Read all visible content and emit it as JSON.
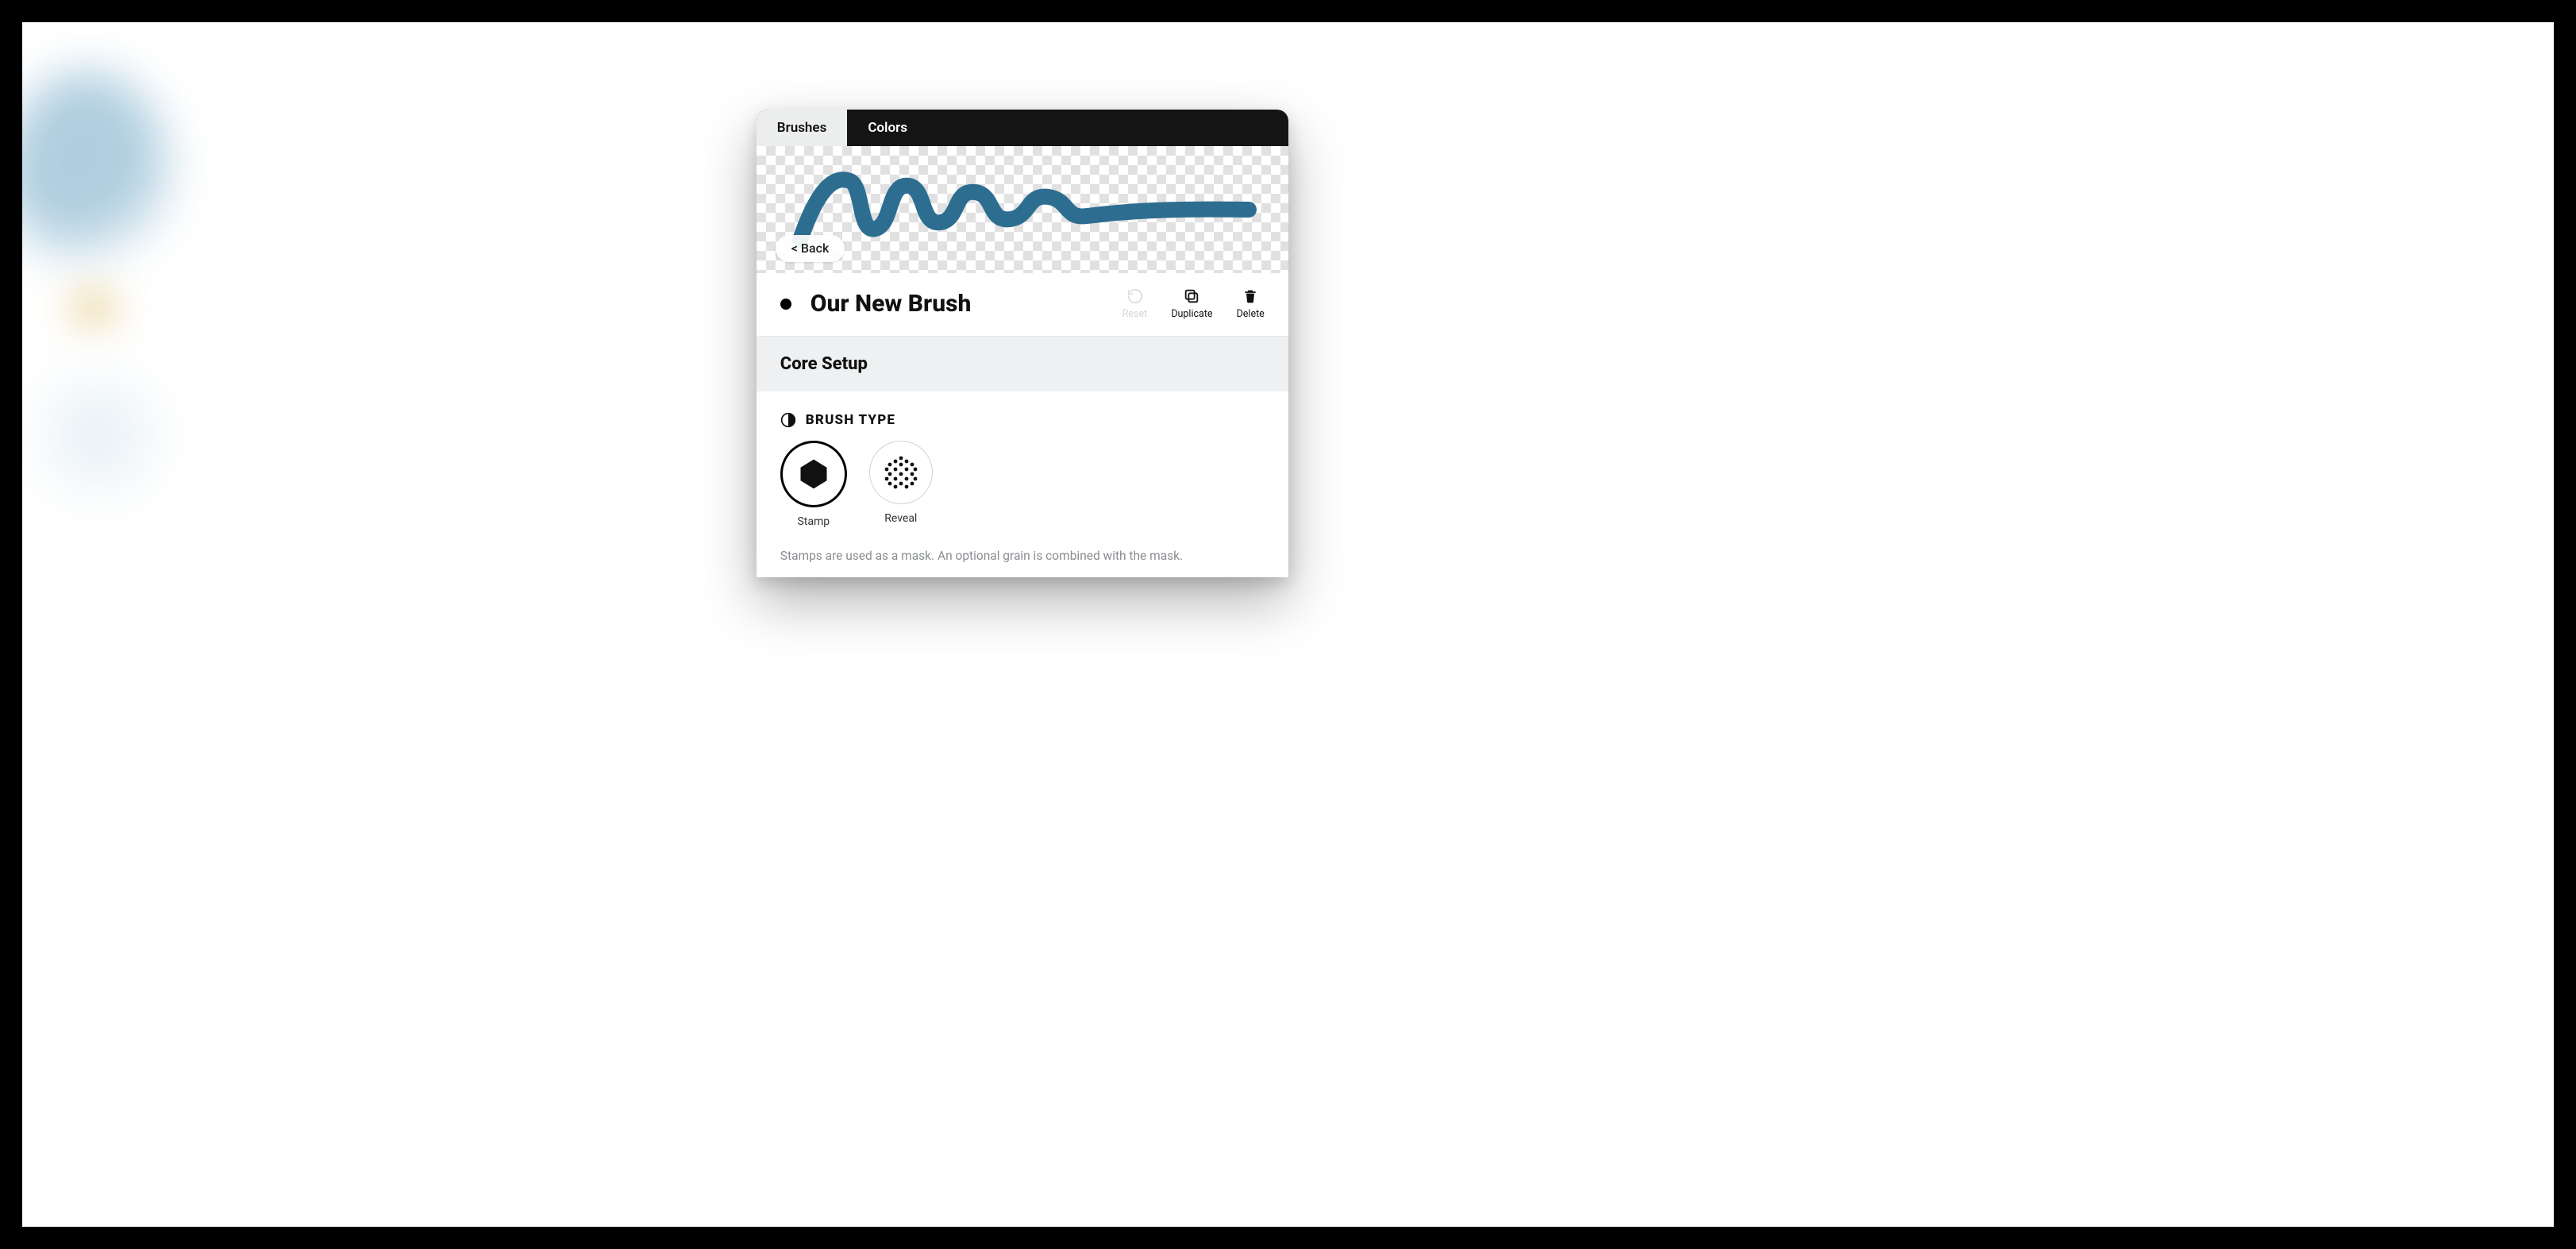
{
  "tabs": {
    "brushes": "Brushes",
    "colors": "Colors"
  },
  "nav": {
    "back": "< Back"
  },
  "brush": {
    "name": "Our New Brush",
    "stroke_color": "#2d6e90"
  },
  "actions": {
    "reset": "Reset",
    "duplicate": "Duplicate",
    "delete": "Delete"
  },
  "sections": {
    "core_setup": "Core Setup"
  },
  "brush_type": {
    "heading": "BRUSH TYPE",
    "options": {
      "stamp": "Stamp",
      "reveal": "Reveal"
    },
    "selected": "stamp",
    "hint": "Stamps are used as a mask. An optional grain is combined with the mask."
  }
}
